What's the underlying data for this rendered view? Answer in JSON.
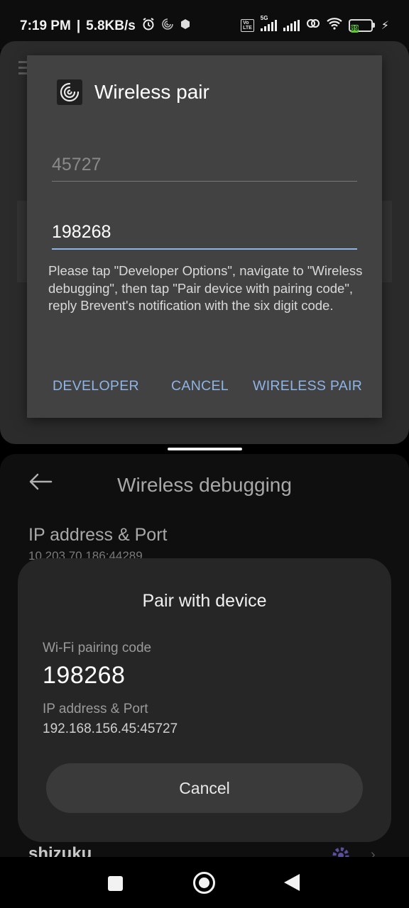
{
  "status_bar": {
    "time": "7:19 PM",
    "net_speed": "5.8KB/s",
    "network_type": "5G",
    "battery_level": "89",
    "icons": [
      "alarm-icon",
      "brevent-icon",
      "hexagon-icon",
      "volte-icon",
      "signal-icon",
      "signal-icon-2",
      "hotspot-icon",
      "wifi-icon",
      "battery-icon",
      "charging-icon"
    ]
  },
  "dialog": {
    "title": "Wireless pair",
    "port_value": "45727",
    "code_value": "198268",
    "message": "Please tap \"Developer Options\", navigate to \"Wireless debugging\", then tap \"Pair device with pairing code\", reply Brevent's notification with the six digit code.",
    "buttons": {
      "developer": "DEVELOPER",
      "cancel": "CANCEL",
      "wireless_pair": "WIRELESS PAIR"
    }
  },
  "settings": {
    "title": "Wireless debugging",
    "ip_label": "IP address & Port",
    "ip_value": "10.203.70.186:44289",
    "app_item": "shizuku"
  },
  "pair_sheet": {
    "title": "Pair with device",
    "code_label": "Wi-Fi pairing code",
    "code": "198268",
    "ip_label": "IP address & Port",
    "ip_value": "192.168.156.45:45727",
    "cancel_label": "Cancel"
  },
  "colors": {
    "accent_blue": "#8fb4e6",
    "dialog_bg": "#424242",
    "sheet_bg": "#262626",
    "battery_green": "#5ec934"
  }
}
